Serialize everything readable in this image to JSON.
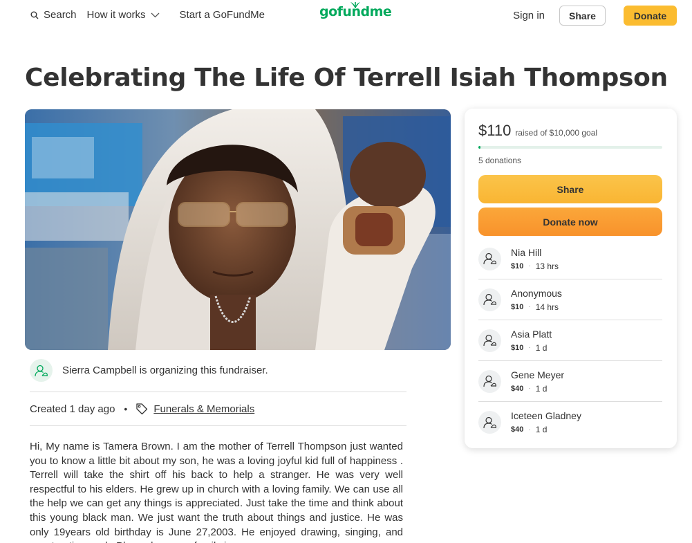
{
  "header": {
    "search_label": "Search",
    "how_it_works_label": "How it works",
    "start_label": "Start a GoFundMe",
    "logo_text": "gofundme",
    "sign_in_label": "Sign in",
    "share_label": "Share",
    "donate_label": "Donate"
  },
  "campaign": {
    "title": "Celebrating The Life Of Terrell Isiah Thompson",
    "organizer_text": "Sierra Campbell is organizing this fundraiser.",
    "created_text": "Created 1 day ago",
    "separator": "•",
    "category": "Funerals & Memorials",
    "story": "Hi, My name is Tamera Brown. I am the mother of Terrell Thompson just wanted you to know a little bit about my son, he was a loving joyful kid full of happiness . Terrell will take the shirt off his back to help a stranger. He was very well respectful to his elders. He grew up in church with a loving family. We can use all the help we can get any things is appreciated. Just take the time and think about this young black man. We just want the truth about things and justice. He was only 19years old birthday is June 27,2003. He enjoyed drawing, singing, and construction work. Please keep our family in prayers."
  },
  "donation_card": {
    "raised": "$110",
    "goal_text": "raised of $10,000 goal",
    "progress_fraction": 0.011,
    "donations_count": "5 donations",
    "share_label": "Share",
    "donate_now_label": "Donate now",
    "donors": [
      {
        "name": "Nia Hill",
        "amount": "$10",
        "time": "13 hrs"
      },
      {
        "name": "Anonymous",
        "amount": "$10",
        "time": "14 hrs"
      },
      {
        "name": "Asia Platt",
        "amount": "$10",
        "time": "1 d"
      },
      {
        "name": "Gene Meyer",
        "amount": "$40",
        "time": "1 d"
      },
      {
        "name": "Iceteen Gladney",
        "amount": "$40",
        "time": "1 d"
      }
    ]
  },
  "colors": {
    "brand_green": "#02a95c",
    "donate_yellow": "#fbbc30",
    "donate_orange": "#f8922b"
  },
  "icons": [
    "search-icon",
    "chevron-down-icon",
    "leaf-logo-icon",
    "organizer-avatar-icon",
    "tag-icon",
    "donor-avatar-icon"
  ]
}
